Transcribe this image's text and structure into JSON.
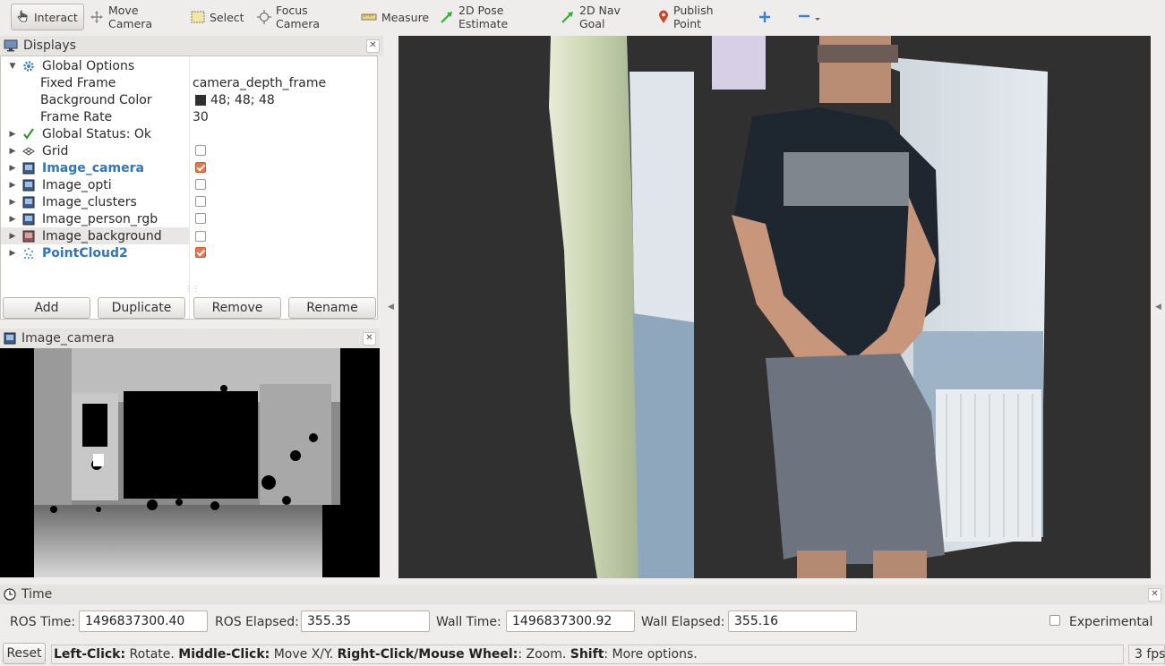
{
  "toolbar": {
    "tools": [
      {
        "label": "Interact",
        "icon": "hand-cursor-icon",
        "active": true
      },
      {
        "label": "Move Camera",
        "icon": "move-camera-icon"
      },
      {
        "label": "Select",
        "icon": "select-box-icon"
      },
      {
        "label": "Focus Camera",
        "icon": "crosshair-icon"
      },
      {
        "label": "Measure",
        "icon": "ruler-icon"
      },
      {
        "label": "2D Pose Estimate",
        "icon": "green-arrow-icon"
      },
      {
        "label": "2D Nav Goal",
        "icon": "green-arrow-icon"
      },
      {
        "label": "Publish Point",
        "icon": "map-pin-icon"
      }
    ],
    "add_tool_icon": "plus-icon",
    "remove_tool_icon": "minus-dropdown-icon"
  },
  "displays_panel": {
    "title": "Displays",
    "global_options": {
      "label": "Global Options",
      "fixed_frame_label": "Fixed Frame",
      "fixed_frame_value": "camera_depth_frame",
      "background_color_label": "Background Color",
      "background_color_value": "48; 48; 48",
      "background_color_swatch": "#303030",
      "frame_rate_label": "Frame Rate",
      "frame_rate_value": "30"
    },
    "global_status": "Global Status: Ok",
    "items": [
      {
        "label": "Grid",
        "checked": false,
        "icon": "grid-icon"
      },
      {
        "label": "Image_camera",
        "checked": true,
        "icon": "image-icon",
        "highlight": true
      },
      {
        "label": "Image_opti",
        "checked": false,
        "icon": "image-icon"
      },
      {
        "label": "Image_clusters",
        "checked": false,
        "icon": "image-icon"
      },
      {
        "label": "Image_person_rgb",
        "checked": false,
        "icon": "image-icon"
      },
      {
        "label": "Image_background",
        "checked": false,
        "icon": "image-icon",
        "selected": true
      },
      {
        "label": "PointCloud2",
        "checked": true,
        "icon": "pointcloud-icon",
        "highlight": true
      }
    ],
    "buttons": {
      "add": "Add",
      "duplicate": "Duplicate",
      "remove": "Remove",
      "rename": "Rename"
    }
  },
  "image_panel": {
    "title": "Image_camera"
  },
  "time_panel": {
    "title": "Time",
    "ros_time_label": "ROS Time:",
    "ros_time_value": "1496837300.40",
    "ros_elapsed_label": "ROS Elapsed:",
    "ros_elapsed_value": "355.35",
    "wall_time_label": "Wall Time:",
    "wall_time_value": "1496837300.92",
    "wall_elapsed_label": "Wall Elapsed:",
    "wall_elapsed_value": "355.16",
    "experimental_label": "Experimental",
    "experimental_checked": false
  },
  "status_bar": {
    "reset_label": "Reset",
    "hint": {
      "left_click_key": "Left-Click:",
      "left_click_text": " Rotate. ",
      "middle_click_key": "Middle-Click:",
      "middle_click_text": " Move X/Y. ",
      "right_click_key": "Right-Click/Mouse Wheel:",
      "right_click_text": ": Zoom. ",
      "shift_key": "Shift",
      "shift_text": ": More options."
    },
    "fps": "3 fps"
  },
  "colors": {
    "accent_blue": "#2f74c0",
    "checked_orange": "#e8764a",
    "status_ok_green": "#2e8b2e"
  }
}
